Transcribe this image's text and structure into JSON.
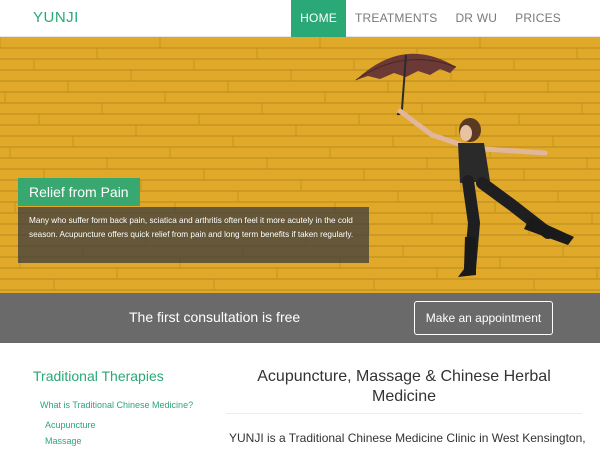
{
  "brand": "YUNJI",
  "nav": {
    "items": [
      {
        "label": "HOME",
        "active": true
      },
      {
        "label": "TREATMENTS",
        "active": false
      },
      {
        "label": "DR WU",
        "active": false
      },
      {
        "label": "PRICES",
        "active": false
      }
    ]
  },
  "hero": {
    "caption_title": "Relief from Pain",
    "caption_body": "Many who suffer form back pain, sciatica and arthritis often feel it more acutely in the cold season. Acupuncture offers quick relief from pain and long term benefits if taken regularly."
  },
  "cta": {
    "text": "The first consultation is free",
    "button_label": "Make an appointment"
  },
  "sidebar": {
    "title": "Traditional Therapies",
    "links": [
      "What is Traditional Chinese Medicine?",
      "Acupuncture",
      "Massage"
    ]
  },
  "main": {
    "title": "Acupuncture, Massage & Chinese Herbal Medicine",
    "intro": "YUNJI is a Traditional Chinese Medicine Clinic in West Kensington,"
  },
  "colors": {
    "accent": "#2aa876",
    "hero_wall": "#e0a92a",
    "cta_bar": "#6a6a6a"
  },
  "icons": [
    "umbrella-image",
    "woman-jumping-image"
  ]
}
